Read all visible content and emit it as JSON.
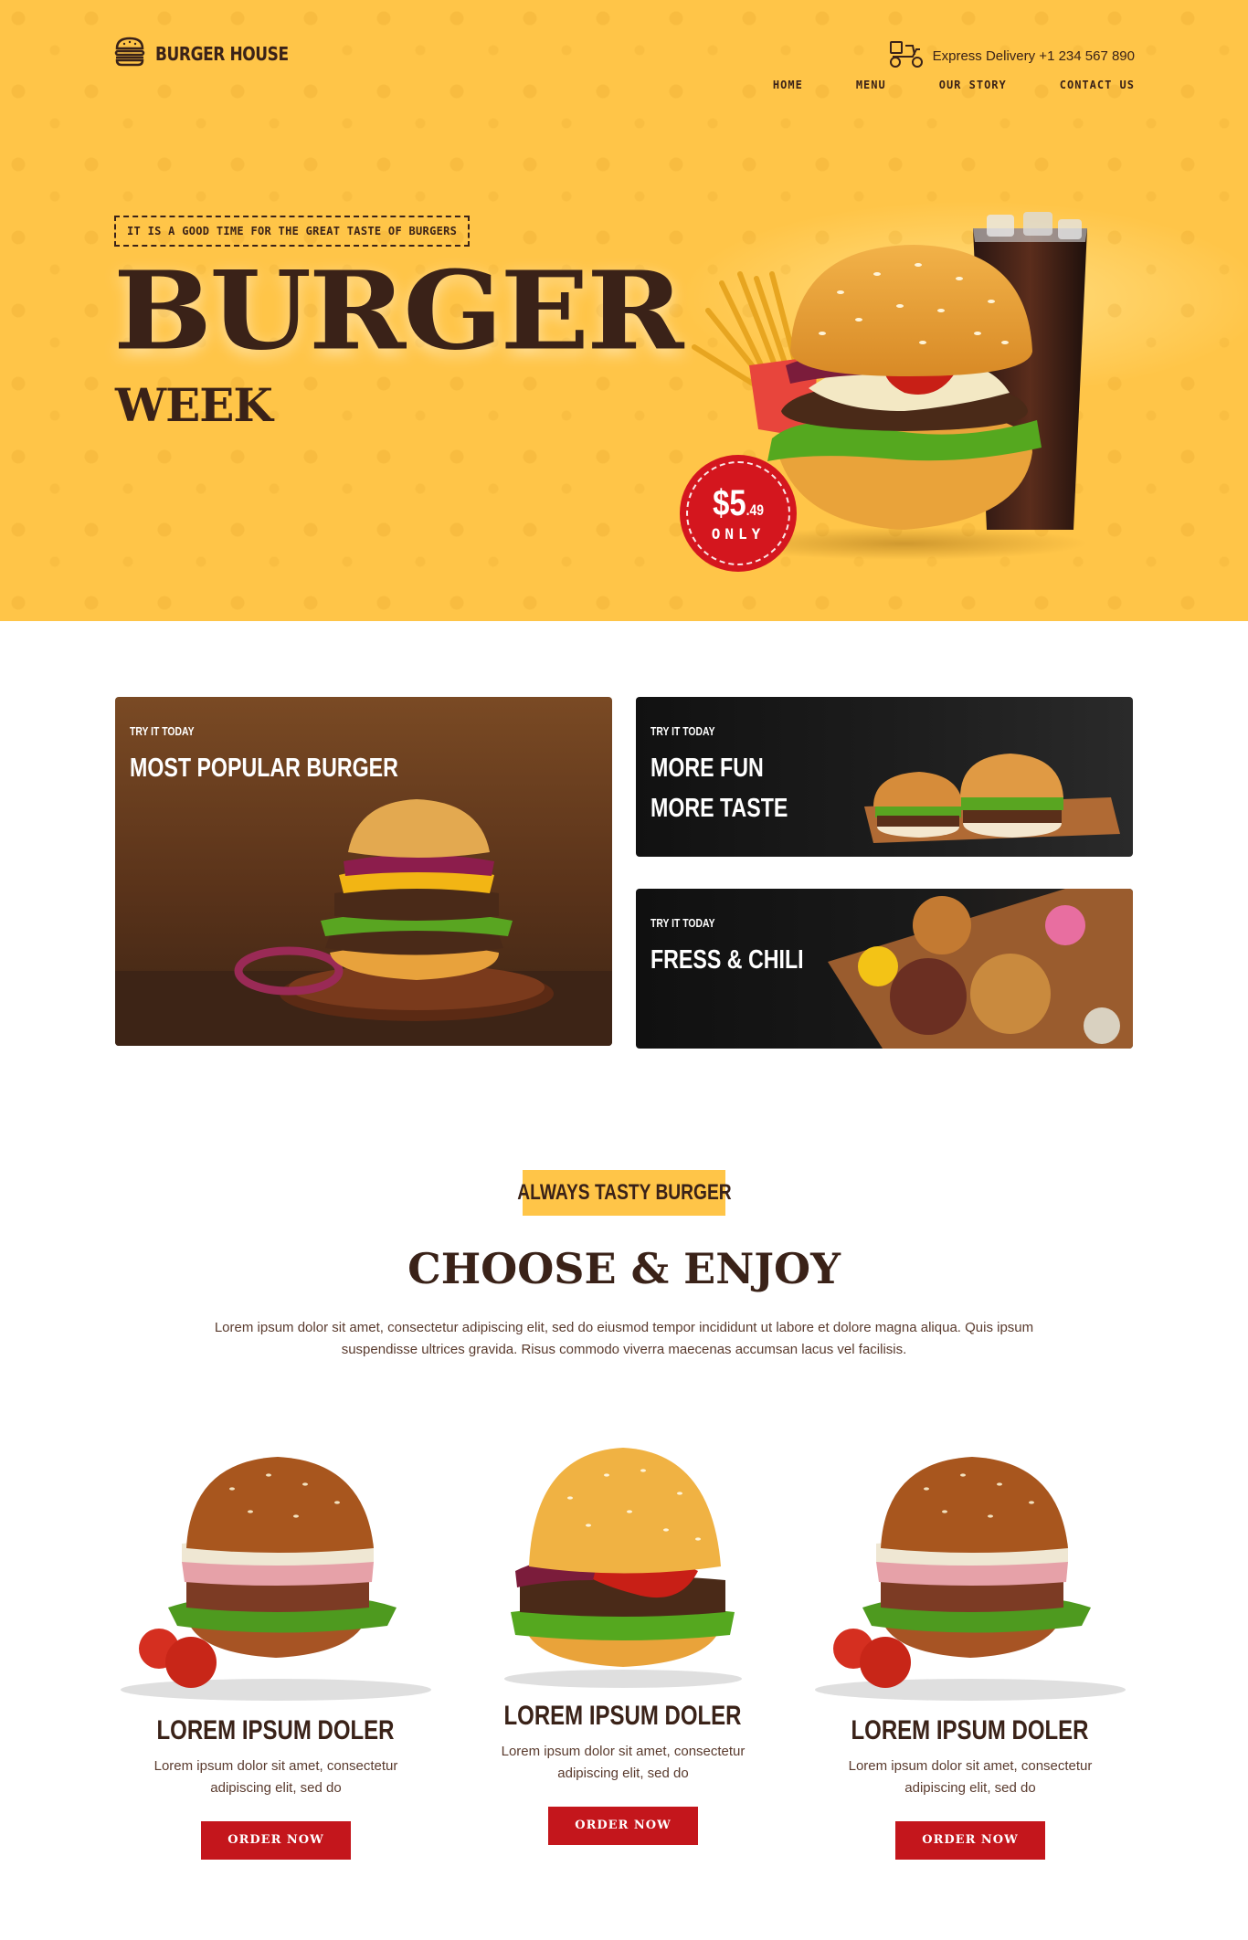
{
  "header": {
    "logo_text": "BURGER HOUSE",
    "delivery_text": "Express Delivery +1 234 567 890",
    "nav": [
      "HOME",
      "MENU",
      "OUR STORY",
      "CONTACT US"
    ]
  },
  "hero": {
    "tagline": "IT IS A GOOD TIME FOR THE GREAT TASTE OF BURGERS",
    "headline": "BURGER",
    "subhead": "WEEK",
    "price": {
      "dollars": "$5",
      "cents": ".49",
      "label": "ONLY"
    }
  },
  "promos": [
    {
      "kicker": "TRY IT TODAY",
      "title_lines": [
        "MOST POPULAR BURGER"
      ]
    },
    {
      "kicker": "TRY IT TODAY",
      "title_lines": [
        "MORE FUN",
        "MORE TASTE"
      ]
    },
    {
      "kicker": "TRY IT TODAY",
      "title_lines": [
        "FRESS & CHILI"
      ]
    }
  ],
  "choose": {
    "pill": "ALWAYS TASTY BURGER",
    "title": "CHOOSE & ENJOY",
    "description": "Lorem ipsum dolor sit amet, consectetur adipiscing elit, sed do eiusmod tempor incididunt ut labore et dolore magna aliqua. Quis ipsum suspendisse ultrices gravida. Risus commodo viverra maecenas accumsan lacus vel facilisis."
  },
  "products": [
    {
      "name": "LOREM IPSUM DOLER",
      "description": "Lorem ipsum dolor sit amet, consectetur adipiscing elit, sed do",
      "button": "ORDER NOW"
    },
    {
      "name": "LOREM IPSUM DOLER",
      "description": "Lorem ipsum dolor sit amet, consectetur adipiscing elit, sed do",
      "button": "ORDER NOW"
    },
    {
      "name": "LOREM IPSUM DOLER",
      "description": "Lorem ipsum dolor sit amet, consectetur adipiscing elit, sed do",
      "button": "ORDER NOW"
    }
  ],
  "colors": {
    "brand_yellow": "#ffc548",
    "brand_brown": "#3a2218",
    "accent_red": "#c4161c"
  },
  "icons": {
    "logo": "burger-icon",
    "delivery": "delivery-scooter-icon"
  }
}
